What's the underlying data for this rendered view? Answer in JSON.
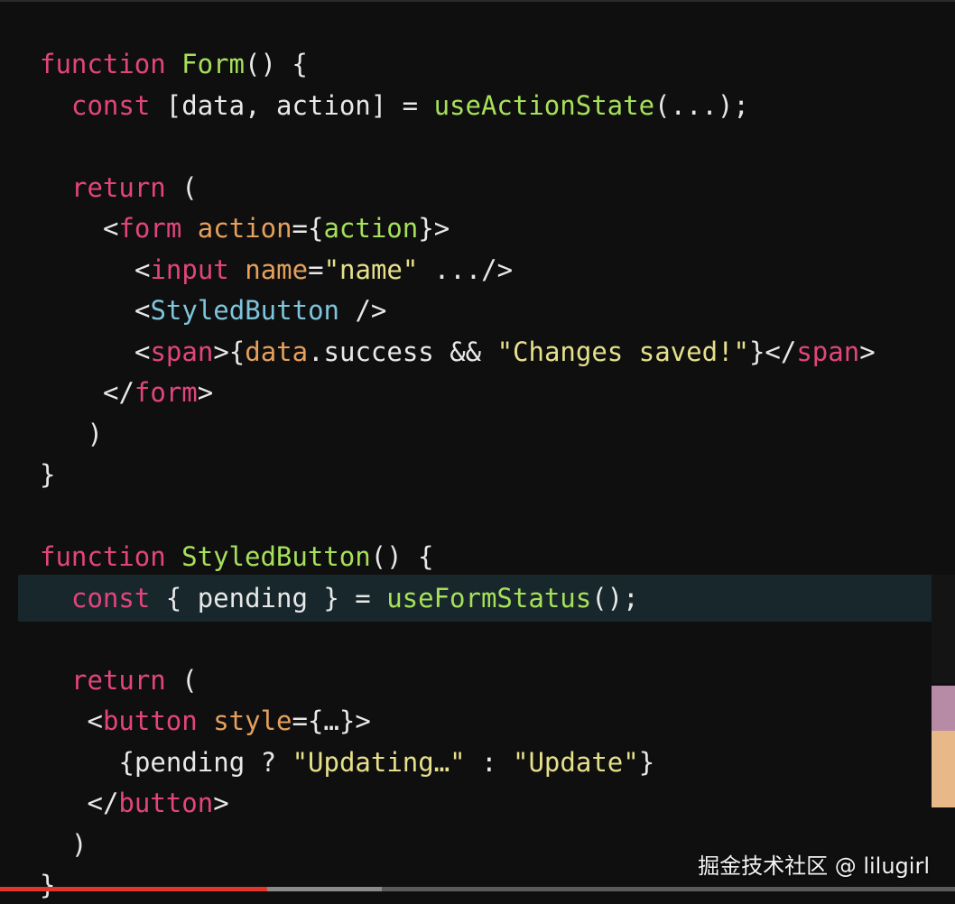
{
  "colors": {
    "keyword": "#e2457c",
    "function_name": "#a6e05a",
    "component": "#7ec5dc",
    "tag": "#e2457c",
    "attribute": "#e6a05c",
    "string": "#e6e08a",
    "punctuation": "#e8e8e8",
    "background": "#0f0f10",
    "highlight": "#18272b",
    "progress_played": "#e3362b"
  },
  "code_lines": [
    {
      "indent": "",
      "tokens": [
        {
          "t": "function",
          "c": "keyword"
        },
        {
          "t": " ",
          "c": "punctuation"
        },
        {
          "t": "Form",
          "c": "function_name"
        },
        {
          "t": "() {",
          "c": "punctuation"
        }
      ]
    },
    {
      "indent": "  ",
      "tokens": [
        {
          "t": "const",
          "c": "keyword"
        },
        {
          "t": " [data, action] = ",
          "c": "punctuation"
        },
        {
          "t": "useActionState",
          "c": "function_name"
        },
        {
          "t": "(...);",
          "c": "punctuation"
        }
      ]
    },
    {
      "indent": "",
      "tokens": []
    },
    {
      "indent": "  ",
      "tokens": [
        {
          "t": "return",
          "c": "keyword"
        },
        {
          "t": " (",
          "c": "punctuation"
        }
      ]
    },
    {
      "indent": "    ",
      "tokens": [
        {
          "t": "<",
          "c": "punctuation"
        },
        {
          "t": "form",
          "c": "tag"
        },
        {
          "t": " ",
          "c": "punctuation"
        },
        {
          "t": "action",
          "c": "attribute"
        },
        {
          "t": "={",
          "c": "punctuation"
        },
        {
          "t": "action",
          "c": "function_name"
        },
        {
          "t": "}>",
          "c": "punctuation"
        }
      ]
    },
    {
      "indent": "      ",
      "tokens": [
        {
          "t": "<",
          "c": "punctuation"
        },
        {
          "t": "input",
          "c": "tag"
        },
        {
          "t": " ",
          "c": "punctuation"
        },
        {
          "t": "name",
          "c": "attribute"
        },
        {
          "t": "=",
          "c": "punctuation"
        },
        {
          "t": "\"name\"",
          "c": "string"
        },
        {
          "t": " .../>",
          "c": "punctuation"
        }
      ]
    },
    {
      "indent": "      ",
      "tokens": [
        {
          "t": "<",
          "c": "punctuation"
        },
        {
          "t": "StyledButton",
          "c": "component"
        },
        {
          "t": " />",
          "c": "punctuation"
        }
      ]
    },
    {
      "indent": "      ",
      "tokens": [
        {
          "t": "<",
          "c": "punctuation"
        },
        {
          "t": "span",
          "c": "tag"
        },
        {
          "t": ">{",
          "c": "punctuation"
        },
        {
          "t": "data",
          "c": "attribute"
        },
        {
          "t": ".success && ",
          "c": "punctuation"
        },
        {
          "t": "\"Changes saved!\"",
          "c": "string"
        },
        {
          "t": "}</",
          "c": "punctuation"
        },
        {
          "t": "span",
          "c": "tag"
        },
        {
          "t": ">",
          "c": "punctuation"
        }
      ]
    },
    {
      "indent": "    ",
      "tokens": [
        {
          "t": "</",
          "c": "punctuation"
        },
        {
          "t": "form",
          "c": "tag"
        },
        {
          "t": ">",
          "c": "punctuation"
        }
      ]
    },
    {
      "indent": "   ",
      "tokens": [
        {
          "t": ")",
          "c": "punctuation"
        }
      ]
    },
    {
      "indent": "",
      "tokens": [
        {
          "t": "}",
          "c": "punctuation"
        }
      ]
    },
    {
      "indent": "",
      "tokens": []
    },
    {
      "indent": "",
      "tokens": [
        {
          "t": "function",
          "c": "keyword"
        },
        {
          "t": " ",
          "c": "punctuation"
        },
        {
          "t": "StyledButton",
          "c": "function_name"
        },
        {
          "t": "() {",
          "c": "punctuation"
        }
      ]
    },
    {
      "indent": "  ",
      "tokens": [
        {
          "t": "const",
          "c": "keyword"
        },
        {
          "t": " { pending } = ",
          "c": "punctuation"
        },
        {
          "t": "useFormStatus",
          "c": "function_name"
        },
        {
          "t": "();",
          "c": "punctuation"
        }
      ]
    },
    {
      "indent": "",
      "tokens": []
    },
    {
      "indent": "  ",
      "tokens": [
        {
          "t": "return",
          "c": "keyword"
        },
        {
          "t": " (",
          "c": "punctuation"
        }
      ]
    },
    {
      "indent": "   ",
      "tokens": [
        {
          "t": "<",
          "c": "punctuation"
        },
        {
          "t": "button",
          "c": "tag"
        },
        {
          "t": " ",
          "c": "punctuation"
        },
        {
          "t": "style",
          "c": "attribute"
        },
        {
          "t": "={…}>",
          "c": "punctuation"
        }
      ]
    },
    {
      "indent": "     ",
      "tokens": [
        {
          "t": "{pending ? ",
          "c": "punctuation"
        },
        {
          "t": "\"Updating…\"",
          "c": "string"
        },
        {
          "t": " : ",
          "c": "punctuation"
        },
        {
          "t": "\"Update\"",
          "c": "string"
        },
        {
          "t": "}",
          "c": "punctuation"
        }
      ]
    },
    {
      "indent": "   ",
      "tokens": [
        {
          "t": "</",
          "c": "punctuation"
        },
        {
          "t": "button",
          "c": "tag"
        },
        {
          "t": ">",
          "c": "punctuation"
        }
      ]
    },
    {
      "indent": "  ",
      "tokens": [
        {
          "t": ")",
          "c": "punctuation"
        }
      ]
    },
    {
      "indent": "",
      "tokens": [
        {
          "t": "}",
          "c": "punctuation"
        }
      ]
    }
  ],
  "highlighted_line_index": 13,
  "video": {
    "progress_played": 0.28,
    "progress_buffered": 0.4
  },
  "watermark": "掘金技术社区 @ lilugirl"
}
